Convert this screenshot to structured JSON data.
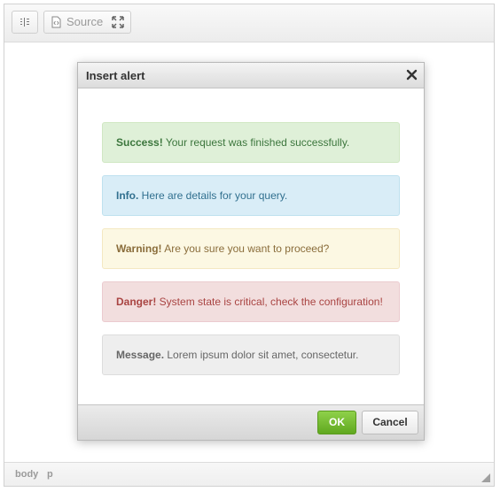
{
  "toolbar": {
    "blocks_icon": "show-blocks-icon",
    "source_label": "Source",
    "source_icon": "source-code-icon",
    "maximize_icon": "maximize-icon"
  },
  "dialog": {
    "title": "Insert alert",
    "close_icon": "close-icon",
    "alerts": [
      {
        "type": "success",
        "bold": "Success!",
        "text": " Your request was finished successfully."
      },
      {
        "type": "info",
        "bold": "Info.",
        "text": " Here are details for your query."
      },
      {
        "type": "warning",
        "bold": "Warning!",
        "text": " Are you sure you want to proceed?"
      },
      {
        "type": "danger",
        "bold": "Danger!",
        "text": " System state is critical, check the configuration!"
      },
      {
        "type": "message",
        "bold": "Message.",
        "text": " Lorem ipsum dolor sit amet, consectetur."
      }
    ],
    "ok_label": "OK",
    "cancel_label": "Cancel"
  },
  "statusbar": {
    "path": [
      "body",
      "p"
    ],
    "resize_icon": "resize-handle-icon"
  },
  "colors": {
    "ok_button": "#6cb82a",
    "success_bg": "#dff0d8",
    "info_bg": "#d9edf7",
    "warning_bg": "#fcf8e3",
    "danger_bg": "#f2dede",
    "message_bg": "#eeeeee"
  }
}
